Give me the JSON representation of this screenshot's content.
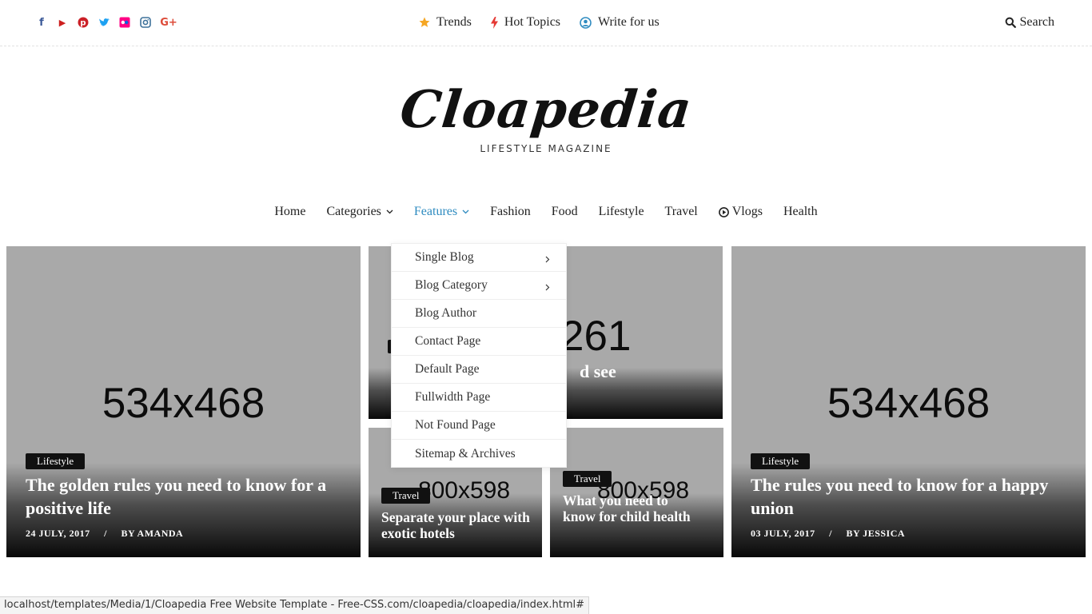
{
  "social_icons": [
    {
      "icon": "facebook-icon",
      "glyph": "f",
      "color": "#3b5998"
    },
    {
      "icon": "youtube-icon",
      "glyph": "▶",
      "color": "#cd201f"
    },
    {
      "icon": "pinterest-icon",
      "glyph": "P",
      "color": "#cb2027"
    },
    {
      "icon": "twitter-icon",
      "glyph": "t",
      "color": "#1da1f2"
    },
    {
      "icon": "flickr-icon",
      "glyph": "••",
      "color": "#ff0084"
    },
    {
      "icon": "instagram-icon",
      "glyph": "◎",
      "color": "#3f729b"
    },
    {
      "icon": "google-plus-icon",
      "glyph": "G+",
      "color": "#dd4b39"
    }
  ],
  "top_links": {
    "trends": "Trends",
    "hot_topics": "Hot Topics",
    "write_for_us": "Write for us",
    "search": "Search"
  },
  "colors": {
    "accent": "#2e8bc0",
    "star": "#f5a623",
    "bolt": "#e53935",
    "user": "#2e8bc0"
  },
  "logo": {
    "brand": "Cloapedia",
    "tagline": "LIFESTYLE MAGAZINE"
  },
  "nav": {
    "home": "Home",
    "categories": "Categories",
    "features": "Features",
    "fashion": "Fashion",
    "food": "Food",
    "lifestyle": "Lifestyle",
    "travel": "Travel",
    "vlogs": "Vlogs",
    "health": "Health"
  },
  "features_menu": [
    "Single Blog",
    "Blog Category",
    "Blog Author",
    "Contact Page",
    "Default Page",
    "Fullwidth Page",
    "Not Found Page",
    "Sitemap & Archives"
  ],
  "cards": {
    "left": {
      "placeholder": "534x468",
      "tag": "Lifestyle",
      "title": "The golden rules you need to know for a positive life",
      "date": "24 JULY, 2017",
      "sep": "/",
      "author": "BY AMANDA"
    },
    "top_mid": {
      "placeholder": "261",
      "title_fragment": "d see"
    },
    "bottom_mid_a": {
      "placeholder": "800x598",
      "tag": "Travel",
      "title": "Separate your place with exotic hotels"
    },
    "bottom_mid_b": {
      "placeholder": "800x598",
      "tag": "Travel",
      "title": "What you need to know for child health"
    },
    "right": {
      "placeholder": "534x468",
      "tag": "Lifestyle",
      "title": "The rules you need to know for a happy union",
      "date": "03 JULY, 2017",
      "sep": "/",
      "author": "BY JESSICA"
    }
  },
  "status_bar": "localhost/templates/Media/1/Cloapedia Free Website Template - Free-CSS.com/cloapedia/cloapedia/index.html#"
}
